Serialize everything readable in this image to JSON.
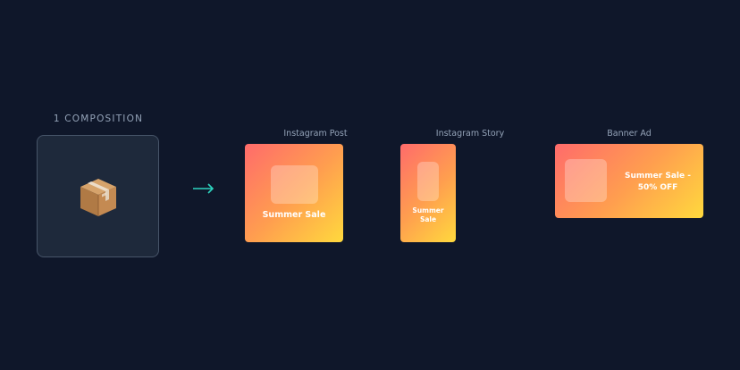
{
  "composition": {
    "label": "1 COMPOSITION",
    "icon": "package-box-icon"
  },
  "arrow": {
    "icon": "right-arrow-icon",
    "color": "#2dd4bf"
  },
  "formats": [
    {
      "label": "Instagram Post",
      "card_text": "Summer Sale"
    },
    {
      "label": "Instagram Story",
      "card_text_line1": "Summer",
      "card_text_line2": "Sale"
    },
    {
      "label": "Banner Ad",
      "card_text_line1": "Summer Sale -",
      "card_text_line2": "50% OFF"
    }
  ],
  "theme": {
    "background": "#0f172a",
    "gradient_start": "#ff6b6b",
    "gradient_mid": "#ff9e4f",
    "gradient_end": "#ffd93d"
  }
}
